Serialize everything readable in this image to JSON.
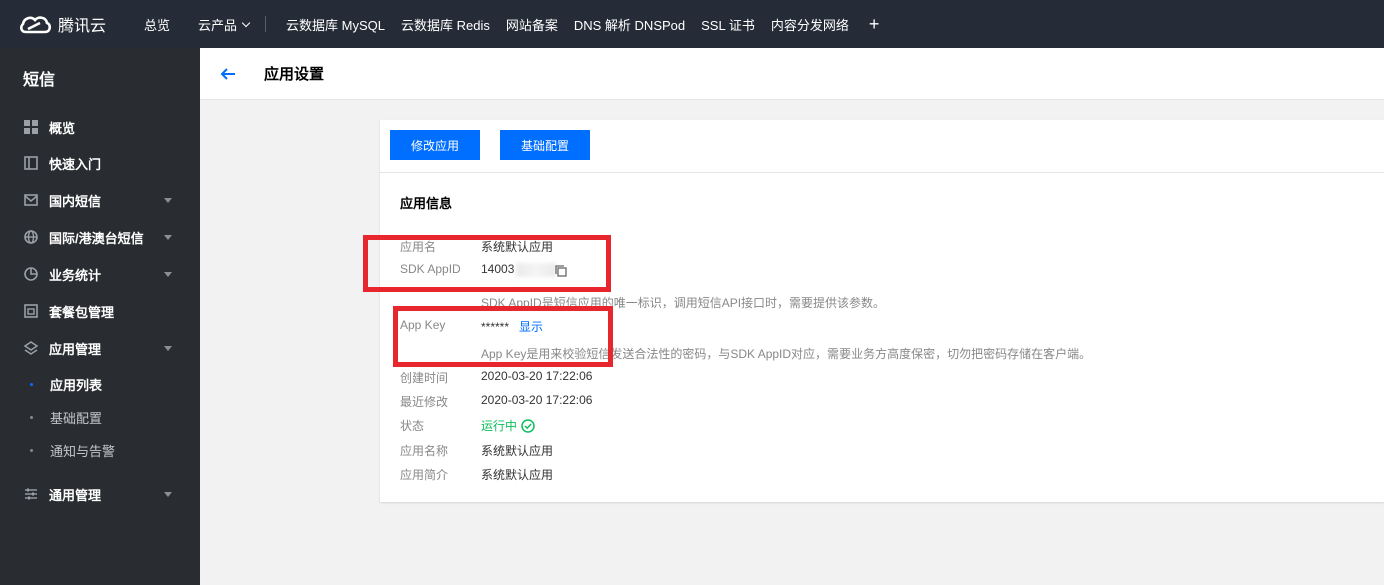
{
  "topbar": {
    "logo_text": "腾讯云",
    "items": [
      "总览",
      "云产品",
      "云数据库 MySQL",
      "云数据库 Redis",
      "网站备案",
      "DNS 解析 DNSPod",
      "SSL 证书",
      "内容分发网络"
    ],
    "plus": "+"
  },
  "sidebar": {
    "title": "短信",
    "items": [
      {
        "label": "概览",
        "icon": "grid-icon"
      },
      {
        "label": "快速入门",
        "icon": "book-icon"
      },
      {
        "label": "国内短信",
        "icon": "mail-icon"
      },
      {
        "label": "国际/港澳台短信",
        "icon": "globe-icon"
      },
      {
        "label": "业务统计",
        "icon": "pie-chart-icon"
      },
      {
        "label": "套餐包管理",
        "icon": "package-icon"
      },
      {
        "label": "应用管理",
        "icon": "layers-icon"
      },
      {
        "label": "通用管理",
        "icon": "sliders-icon"
      }
    ],
    "sub_items": [
      "应用列表",
      "基础配置",
      "通知与告警"
    ]
  },
  "header": {
    "title": "应用设置"
  },
  "card": {
    "buttons": [
      "修改应用",
      "基础配置"
    ],
    "section_title": "应用信息",
    "rows": {
      "app_name_label": "应用名",
      "app_name_value": "系统默认应用",
      "sdk_appid_label": "SDK AppID",
      "sdk_appid_value": "14003",
      "sdk_appid_help": "SDK AppID是短信应用的唯一标识，调用短信API接口时，需要提供该参数。",
      "app_key_label": "App Key",
      "app_key_value": "******",
      "app_key_show": "显示",
      "app_key_help": "App Key是用来校验短信发送合法性的密码，与SDK AppID对应，需要业务方高度保密，切勿把密码存储在客户端。",
      "created_label": "创建时间",
      "created_value": "2020-03-20 17:22:06",
      "modified_label": "最近修改",
      "modified_value": "2020-03-20 17:22:06",
      "status_label": "状态",
      "status_value": "运行中",
      "name_label": "应用名称",
      "name_value": "系统默认应用",
      "intro_label": "应用简介",
      "intro_value": "系统默认应用"
    }
  },
  "colors": {
    "topbar_bg": "#262c37",
    "sidebar_bg": "#292d31",
    "primary": "#006eff",
    "success": "#0abf5b",
    "annotation_red": "#e8262d"
  }
}
